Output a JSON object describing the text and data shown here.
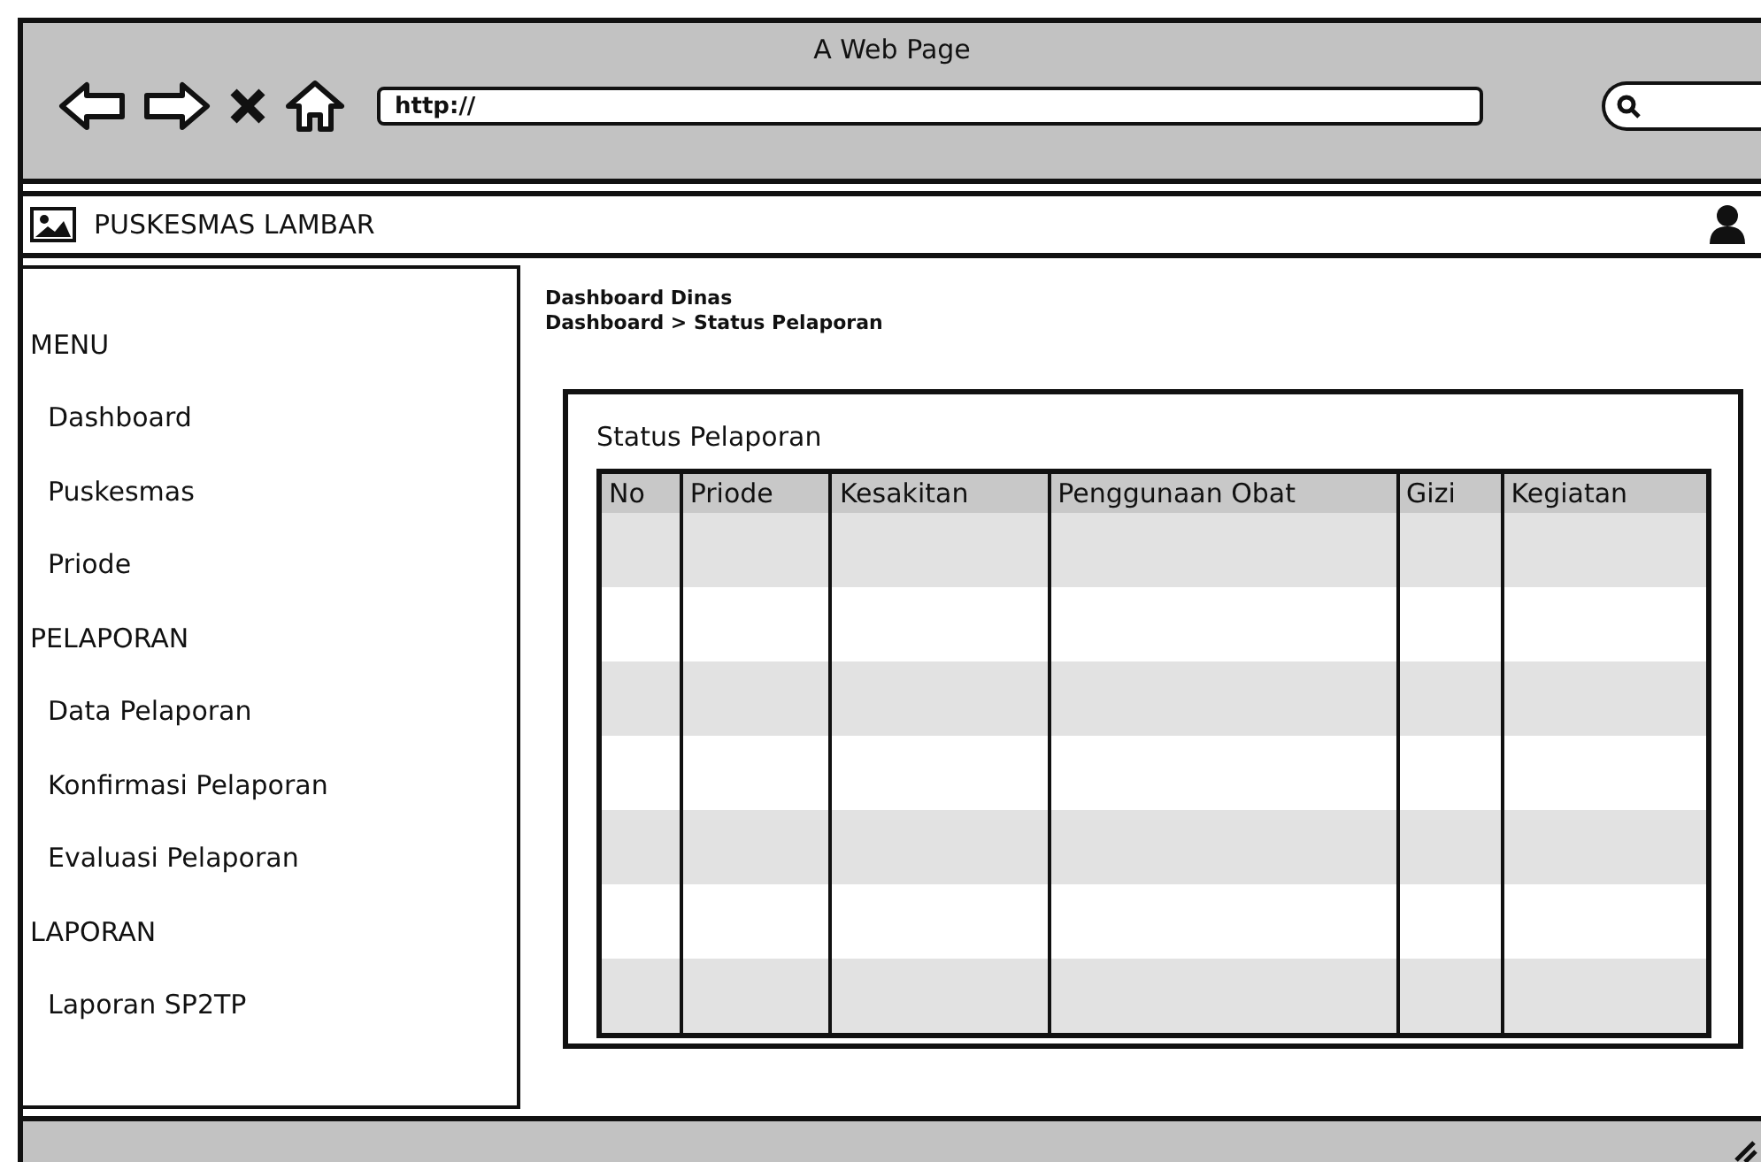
{
  "browser": {
    "title": "A Web Page",
    "url": "http://"
  },
  "header": {
    "brand": "PUSKESMAS LAMBAR"
  },
  "sidebar": {
    "items": [
      {
        "kind": "heading",
        "label": "MENU"
      },
      {
        "kind": "item",
        "label": "Dashboard"
      },
      {
        "kind": "item",
        "label": "Puskesmas"
      },
      {
        "kind": "item",
        "label": "Priode"
      },
      {
        "kind": "heading",
        "label": "PELAPORAN"
      },
      {
        "kind": "item",
        "label": "Data Pelaporan"
      },
      {
        "kind": "item",
        "label": "Konfirmasi Pelaporan"
      },
      {
        "kind": "item",
        "label": "Evaluasi Pelaporan"
      },
      {
        "kind": "heading",
        "label": "LAPORAN"
      },
      {
        "kind": "item",
        "label": "Laporan SP2TP"
      }
    ]
  },
  "page": {
    "title": "Dashboard Dinas",
    "breadcrumb": "Dashboard > Status Pelaporan"
  },
  "panel": {
    "title": "Status Pelaporan",
    "table": {
      "columns": [
        "No",
        "Priode",
        "Kesakitan",
        "Penggunaan Obat",
        "Gizi",
        "Kegiatan"
      ]
    }
  }
}
